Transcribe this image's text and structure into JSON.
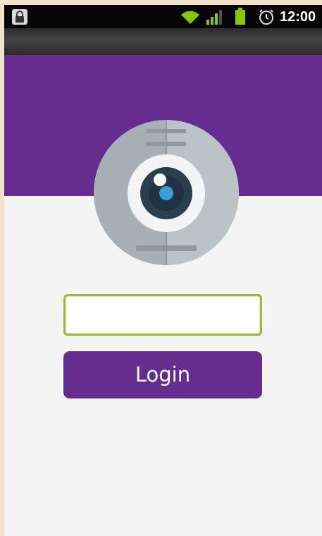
{
  "status_bar": {
    "time": "12:00",
    "icons": [
      "lock-icon",
      "wifi-icon",
      "signal-icon",
      "battery-icon",
      "alarm-icon"
    ]
  },
  "logo": {
    "icon": "camera-icon"
  },
  "form": {
    "username_value": "",
    "username_placeholder": "",
    "login_label": "Login"
  },
  "colors": {
    "brand": "#662d91",
    "input_focus_border": "#9ab93a",
    "background": "#f4f4f4"
  }
}
